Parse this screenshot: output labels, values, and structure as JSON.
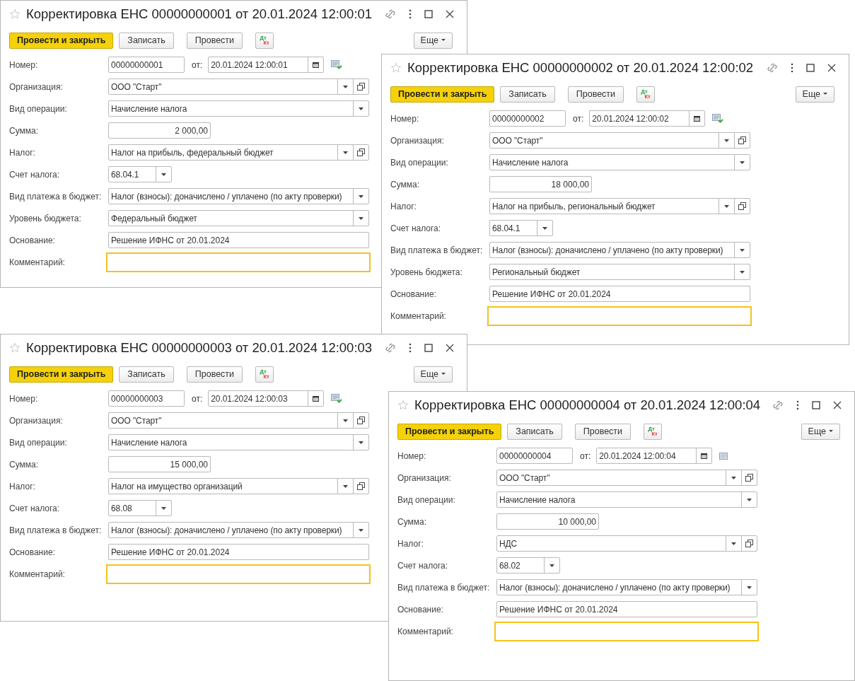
{
  "windows": [
    {
      "title": "Корректировка ЕНС 00000000001 от 20.01.2024 12:00:01",
      "toolbar": [
        {
          "kind": "primary",
          "label": "Провести и закрыть"
        },
        {
          "kind": "plain",
          "label": "Записать"
        },
        {
          "kind": "plain",
          "label": "Провести"
        },
        {
          "kind": "dtkt",
          "top": "Дт",
          "bottom": "Кт"
        },
        {
          "kind": "more",
          "label": "Еще"
        }
      ],
      "fields": [
        {
          "kind": "number_date",
          "label": "Номер:",
          "value": "00000000001",
          "date_label": "от:",
          "date": "20.01.2024 12:00:01",
          "posted": true
        },
        {
          "kind": "select_open",
          "label": "Организация:",
          "value": "ООО \"Старт\""
        },
        {
          "kind": "select",
          "label": "Вид операции:",
          "value": "Начисление налога"
        },
        {
          "kind": "amount",
          "label": "Сумма:",
          "value": "2 000,00"
        },
        {
          "kind": "select_open",
          "label": "Налог:",
          "value": "Налог на прибыль, федеральный бюджет"
        },
        {
          "kind": "short_select",
          "label": "Счет налога:",
          "value": "68.04.1"
        },
        {
          "kind": "select",
          "label": "Вид платежа в бюджет:",
          "value": "Налог (взносы): доначислено / уплачено (по акту проверки)"
        },
        {
          "kind": "select",
          "label": "Уровень бюджета:",
          "value": "Федеральный бюджет"
        },
        {
          "kind": "text",
          "label": "Основание:",
          "value": "Решение ИФНС от 20.01.2024"
        },
        {
          "kind": "comment",
          "label": "Комментарий:"
        }
      ]
    },
    {
      "title": "Корректировка ЕНС 00000000002 от 20.01.2024 12:00:02",
      "toolbar": [
        {
          "kind": "primary",
          "label": "Провести и закрыть"
        },
        {
          "kind": "plain",
          "label": "Записать"
        },
        {
          "kind": "plain",
          "label": "Провести"
        },
        {
          "kind": "dtkt",
          "top": "Дт",
          "bottom": "Кт"
        },
        {
          "kind": "more",
          "label": "Еще"
        }
      ],
      "fields": [
        {
          "kind": "number_date",
          "label": "Номер:",
          "value": "00000000002",
          "date_label": "от:",
          "date": "20.01.2024 12:00:02",
          "posted": true
        },
        {
          "kind": "select_open",
          "label": "Организация:",
          "value": "ООО \"Старт\""
        },
        {
          "kind": "select",
          "label": "Вид операции:",
          "value": "Начисление налога"
        },
        {
          "kind": "amount",
          "label": "Сумма:",
          "value": "18 000,00"
        },
        {
          "kind": "select_open",
          "label": "Налог:",
          "value": "Налог на прибыль, региональный бюджет"
        },
        {
          "kind": "short_select",
          "label": "Счет налога:",
          "value": "68.04.1"
        },
        {
          "kind": "select",
          "label": "Вид платежа в бюджет:",
          "value": "Налог (взносы): доначислено / уплачено (по акту проверки)"
        },
        {
          "kind": "select",
          "label": "Уровень бюджета:",
          "value": "Региональный бюджет"
        },
        {
          "kind": "text",
          "label": "Основание:",
          "value": "Решение ИФНС от 20.01.2024"
        },
        {
          "kind": "comment",
          "label": "Комментарий:"
        }
      ]
    },
    {
      "title": "Корректировка ЕНС 00000000003 от 20.01.2024 12:00:03",
      "toolbar": [
        {
          "kind": "primary",
          "label": "Провести и закрыть"
        },
        {
          "kind": "plain",
          "label": "Записать"
        },
        {
          "kind": "plain",
          "label": "Провести"
        },
        {
          "kind": "dtkt",
          "top": "Дт",
          "bottom": "Кт"
        },
        {
          "kind": "more",
          "label": "Еще"
        }
      ],
      "fields": [
        {
          "kind": "number_date",
          "label": "Номер:",
          "value": "00000000003",
          "date_label": "от:",
          "date": "20.01.2024 12:00:03",
          "posted": true
        },
        {
          "kind": "select_open",
          "label": "Организация:",
          "value": "ООО \"Старт\""
        },
        {
          "kind": "select",
          "label": "Вид операции:",
          "value": "Начисление налога"
        },
        {
          "kind": "amount",
          "label": "Сумма:",
          "value": "15 000,00"
        },
        {
          "kind": "select_open",
          "label": "Налог:",
          "value": "Налог на имущество организаций"
        },
        {
          "kind": "short_select",
          "label": "Счет налога:",
          "value": "68.08"
        },
        {
          "kind": "select",
          "label": "Вид платежа в бюджет:",
          "value": "Налог (взносы): доначислено / уплачено (по акту проверки)"
        },
        {
          "kind": "text",
          "label": "Основание:",
          "value": "Решение ИФНС от 20.01.2024"
        },
        {
          "kind": "comment",
          "label": "Комментарий:"
        }
      ]
    },
    {
      "title": "Корректировка ЕНС 00000000004 от 20.01.2024 12:00:04",
      "toolbar": [
        {
          "kind": "primary",
          "label": "Провести и закрыть"
        },
        {
          "kind": "plain",
          "label": "Записать"
        },
        {
          "kind": "plain",
          "label": "Провести"
        },
        {
          "kind": "dtkt",
          "top": "Дт",
          "bottom": "Кт"
        },
        {
          "kind": "more",
          "label": "Еще"
        }
      ],
      "fields": [
        {
          "kind": "number_date",
          "label": "Номер:",
          "value": "00000000004",
          "date_label": "от:",
          "date": "20.01.2024 12:00:04",
          "posted": false
        },
        {
          "kind": "select_open",
          "label": "Организация:",
          "value": "ООО \"Старт\""
        },
        {
          "kind": "select",
          "label": "Вид операции:",
          "value": "Начисление налога"
        },
        {
          "kind": "amount",
          "label": "Сумма:",
          "value": "10 000,00"
        },
        {
          "kind": "select_open",
          "label": "Налог:",
          "value": "НДС"
        },
        {
          "kind": "short_select",
          "label": "Счет налога:",
          "value": "68.02"
        },
        {
          "kind": "select",
          "label": "Вид платежа в бюджет:",
          "value": "Налог (взносы): доначислено / уплачено (по акту проверки)"
        },
        {
          "kind": "text",
          "label": "Основание:",
          "value": "Решение ИФНС от 20.01.2024"
        },
        {
          "kind": "comment",
          "label": "Комментарий:"
        }
      ]
    }
  ]
}
